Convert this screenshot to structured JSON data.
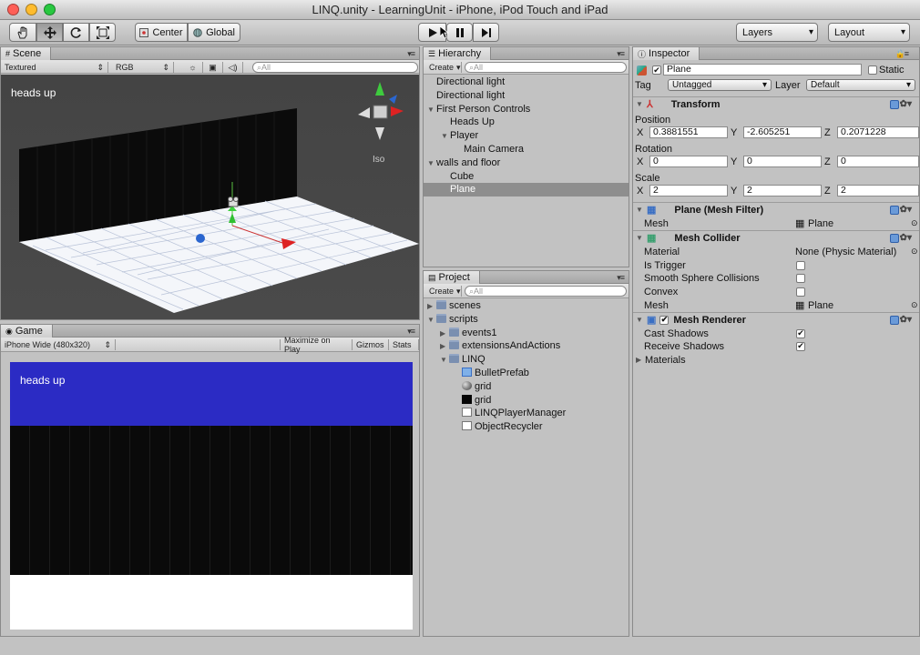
{
  "window": {
    "title": "LINQ.unity - LearningUnit - iPhone, iPod Touch and iPad"
  },
  "toolbar": {
    "center_label": "Center",
    "global_label": "Global",
    "layers_label": "Layers",
    "layout_label": "Layout"
  },
  "scene": {
    "tab": "Scene",
    "render_mode": "Textured",
    "color_mode": "RGB",
    "search_placeholder": "All",
    "overlay_text": "heads up",
    "gizmo_label": "Iso"
  },
  "game": {
    "tab": "Game",
    "aspect": "iPhone Wide (480x320)",
    "maximize_label": "Maximize on Play",
    "gizmos_label": "Gizmos",
    "stats_label": "Stats",
    "hud_text": "heads up",
    "hud_color": "#2b2bc4"
  },
  "hierarchy": {
    "tab": "Hierarchy",
    "create_label": "Create",
    "search_placeholder": "All",
    "items": [
      {
        "label": "Directional light",
        "depth": 0,
        "arrow": ""
      },
      {
        "label": "Directional light",
        "depth": 0,
        "arrow": ""
      },
      {
        "label": "First Person Controls",
        "depth": 0,
        "arrow": "open"
      },
      {
        "label": "Heads Up",
        "depth": 1,
        "arrow": ""
      },
      {
        "label": "Player",
        "depth": 1,
        "arrow": "open"
      },
      {
        "label": "Main Camera",
        "depth": 2,
        "arrow": ""
      },
      {
        "label": "walls and floor",
        "depth": 0,
        "arrow": "open"
      },
      {
        "label": "Cube",
        "depth": 1,
        "arrow": ""
      },
      {
        "label": "Plane",
        "depth": 1,
        "arrow": "",
        "selected": true
      }
    ]
  },
  "project": {
    "tab": "Project",
    "create_label": "Create",
    "search_placeholder": "All",
    "items": [
      {
        "label": "scenes",
        "depth": 0,
        "arrow": "closed",
        "icon": "folder-icon"
      },
      {
        "label": "scripts",
        "depth": 0,
        "arrow": "open",
        "icon": "folder-icon"
      },
      {
        "label": "events1",
        "depth": 1,
        "arrow": "closed",
        "icon": "folder-icon"
      },
      {
        "label": "extensionsAndActions",
        "depth": 1,
        "arrow": "closed",
        "icon": "folder-icon"
      },
      {
        "label": "LINQ",
        "depth": 1,
        "arrow": "open",
        "icon": "folder-icon"
      },
      {
        "label": "BulletPrefab",
        "depth": 2,
        "arrow": "",
        "icon": "prefab-icon"
      },
      {
        "label": "grid",
        "depth": 2,
        "arrow": "",
        "icon": "material-sphere-icon"
      },
      {
        "label": "grid",
        "depth": 2,
        "arrow": "",
        "icon": "texture-icon"
      },
      {
        "label": "LINQPlayerManager",
        "depth": 2,
        "arrow": "",
        "icon": "script-icon"
      },
      {
        "label": "ObjectRecycler",
        "depth": 2,
        "arrow": "",
        "icon": "script-icon"
      }
    ]
  },
  "inspector": {
    "tab": "Inspector",
    "object_name": "Plane",
    "static_label": "Static",
    "tag_label": "Tag",
    "tag_value": "Untagged",
    "layer_label": "Layer",
    "layer_value": "Default",
    "transform": {
      "title": "Transform",
      "position_label": "Position",
      "position": {
        "x": "0.3881551",
        "y": "-2.605251",
        "z": "0.2071228"
      },
      "rotation_label": "Rotation",
      "rotation": {
        "x": "0",
        "y": "0",
        "z": "0"
      },
      "scale_label": "Scale",
      "scale": {
        "x": "2",
        "y": "2",
        "z": "2"
      }
    },
    "mesh_filter": {
      "title": "Plane (Mesh Filter)",
      "mesh_label": "Mesh",
      "mesh_value": "Plane"
    },
    "mesh_collider": {
      "title": "Mesh Collider",
      "material_label": "Material",
      "material_value": "None (Physic Material)",
      "is_trigger_label": "Is Trigger",
      "smooth_label": "Smooth Sphere Collisions",
      "convex_label": "Convex",
      "mesh_label": "Mesh",
      "mesh_value": "Plane"
    },
    "mesh_renderer": {
      "title": "Mesh Renderer",
      "cast_label": "Cast Shadows",
      "receive_label": "Receive Shadows",
      "materials_label": "Materials"
    },
    "axis": {
      "x": "X",
      "y": "Y",
      "z": "Z"
    }
  }
}
